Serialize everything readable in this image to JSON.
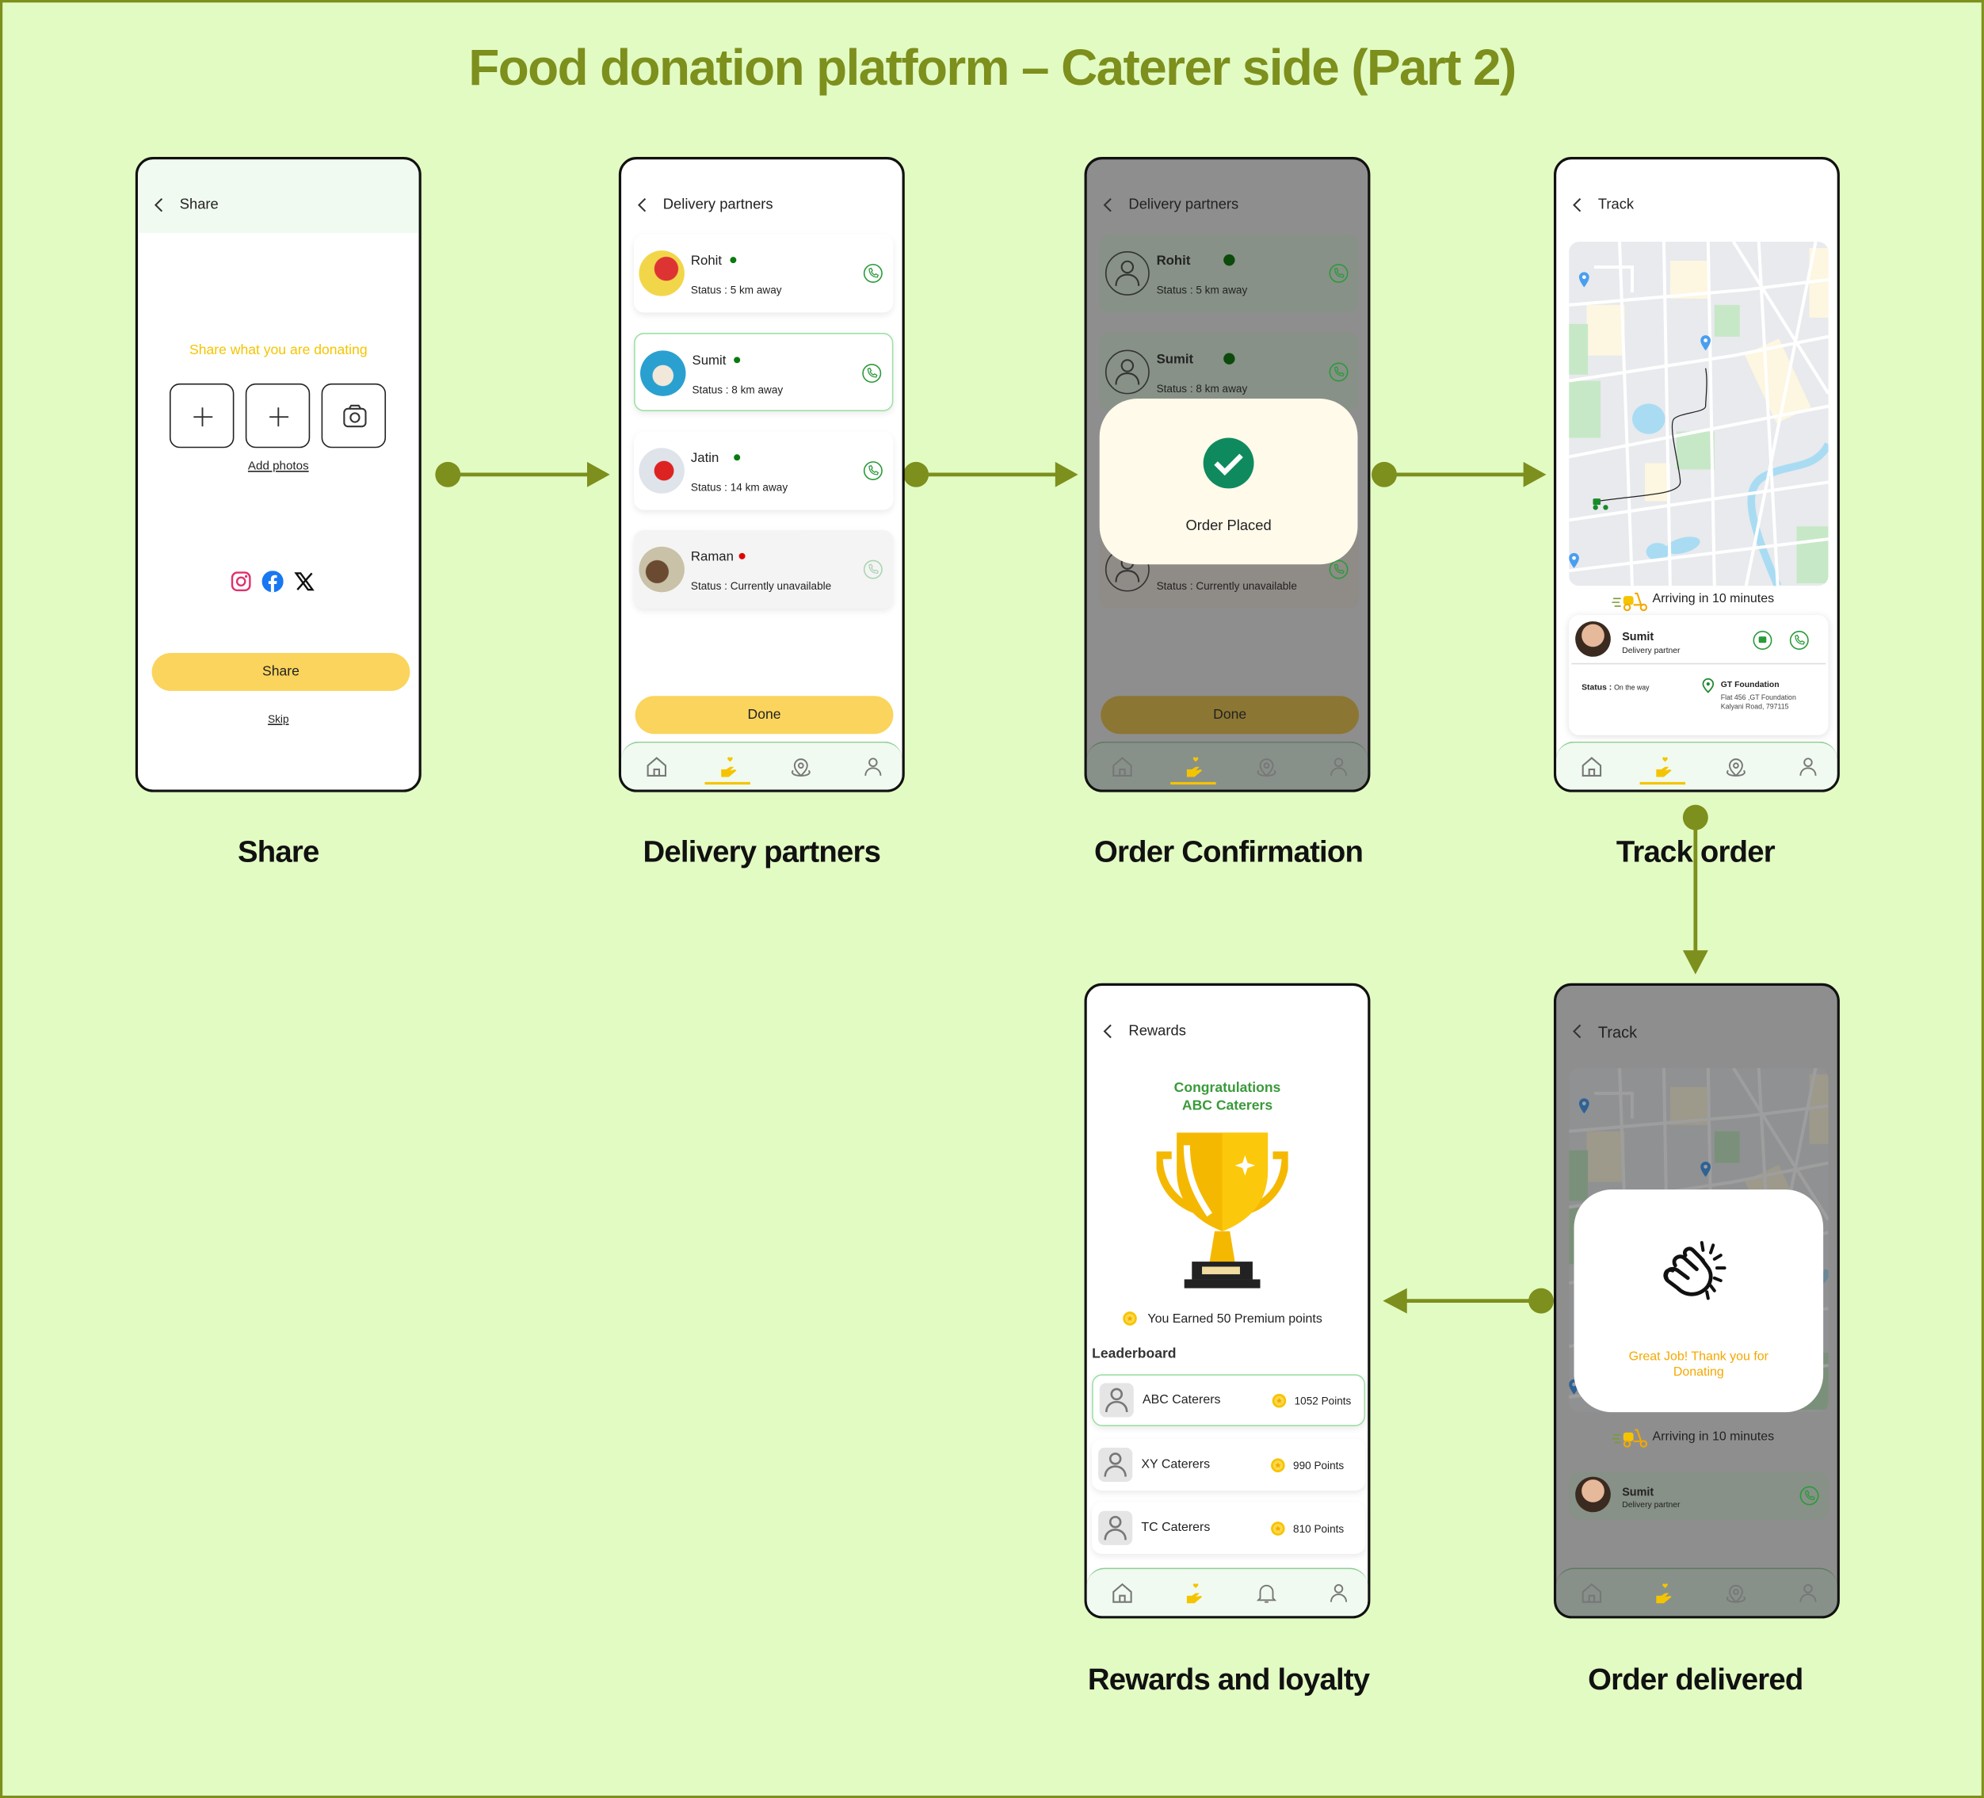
{
  "title": "Food donation platform  – Caterer side (Part 2)",
  "colors": {
    "background": "#e2fbc3",
    "accent": "#7d8f1c",
    "button": "#fad45c",
    "online": "#0a7a10",
    "offline": "#e00000",
    "success": "#0f8a5f"
  },
  "captions": {
    "share": "Share",
    "delivery": "Delivery partners",
    "confirm": "Order Confirmation",
    "track": "Track order",
    "rewards": "Rewards and loyalty",
    "delivered": "Order delivered"
  },
  "share_screen": {
    "header": "Share",
    "prompt": "Share what you are donating",
    "add_photos": "Add photos",
    "share_button": "Share",
    "skip": "Skip",
    "social": [
      "instagram-icon",
      "facebook-icon",
      "x-icon"
    ]
  },
  "delivery_screen": {
    "header": "Delivery partners",
    "partners": [
      {
        "name": "Rohit",
        "status": "Status : 5 km away",
        "online": true
      },
      {
        "name": "Sumit",
        "status": "Status : 8 km away",
        "online": true
      },
      {
        "name": "Jatin",
        "status": "Status : 14 km away",
        "online": true
      },
      {
        "name": "Raman",
        "status": "Status : Currently unavailable",
        "online": false
      }
    ],
    "done": "Done"
  },
  "confirm_screen": {
    "header": "Delivery partners",
    "partners": [
      {
        "name": "Rohit",
        "status": "Status : 5 km away"
      },
      {
        "name": "Sumit",
        "status": "Status : 8 km away"
      },
      {
        "status": "Status : Currently unavailable"
      }
    ],
    "done": "Done",
    "modal": "Order Placed"
  },
  "track_screen": {
    "header": "Track",
    "eta": "Arriving in 10 minutes",
    "partner_name": "Sumit",
    "partner_role": "Delivery partner",
    "status_label": "Status :",
    "status_value": "On the way",
    "dest_name": "GT Foundation",
    "dest_addr1": "Flat 456 ,GT Foundation",
    "dest_addr2": "Kalyani Road, 797115"
  },
  "rewards_screen": {
    "header": "Rewards",
    "congrats": "Congratulations",
    "org": "ABC Caterers",
    "earned": "You Earned 50 Premium points",
    "leaderboard": "Leaderboard",
    "rows": [
      {
        "name": "ABC Caterers",
        "points": "1052 Points"
      },
      {
        "name": "XY Caterers",
        "points": "990 Points"
      },
      {
        "name": "TC Caterers",
        "points": "810 Points"
      }
    ]
  },
  "delivered_screen": {
    "header": "Track",
    "modal": "Great Job! Thank you for Donating",
    "eta": "Arriving in 10 minutes",
    "partner_name": "Sumit",
    "partner_role": "Delivery partner"
  },
  "nav": {
    "items": [
      "home-icon",
      "donate-icon",
      "location-icon",
      "profile-icon"
    ],
    "rewards_items": [
      "home-icon",
      "donate-icon",
      "bell-icon",
      "profile-icon"
    ]
  }
}
